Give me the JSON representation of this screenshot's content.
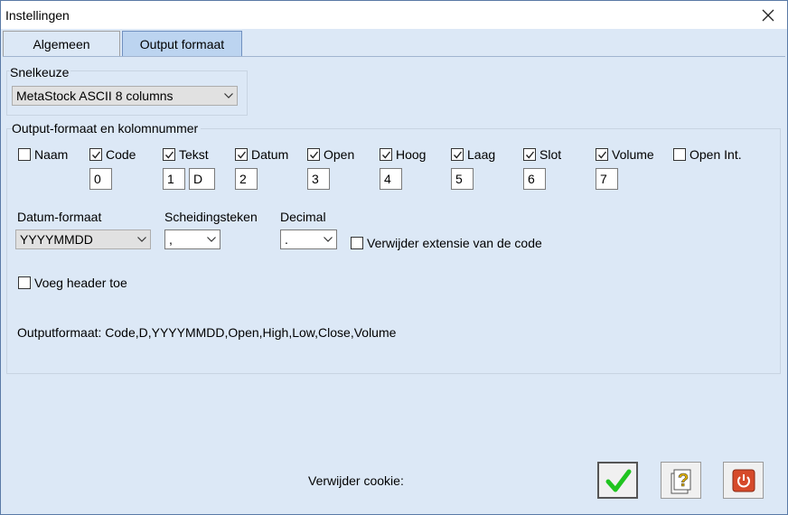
{
  "window": {
    "title": "Instellingen",
    "close_icon": "close-icon"
  },
  "tabs": [
    {
      "label": "Algemeen"
    },
    {
      "label": "Output formaat"
    }
  ],
  "snelkeuze": {
    "label": "Snelkeuze",
    "selected": "MetaStock ASCII 8 columns"
  },
  "output_group": {
    "label": "Output-formaat en kolomnummer",
    "fields": [
      {
        "label": "Naam",
        "checked": false
      },
      {
        "label": "Code",
        "checked": true,
        "col": "0"
      },
      {
        "label": "Tekst",
        "checked": true,
        "col": "1",
        "extra": "D"
      },
      {
        "label": "Datum",
        "checked": true,
        "col": "2"
      },
      {
        "label": "Open",
        "checked": true,
        "col": "3"
      },
      {
        "label": "Hoog",
        "checked": true,
        "col": "4"
      },
      {
        "label": "Laag",
        "checked": true,
        "col": "5"
      },
      {
        "label": "Slot",
        "checked": true,
        "col": "6"
      },
      {
        "label": "Volume",
        "checked": true,
        "col": "7"
      },
      {
        "label": "Open Int.",
        "checked": false
      }
    ]
  },
  "datum_formaat": {
    "label": "Datum-formaat",
    "selected": "YYYYMMDD"
  },
  "scheidingsteken": {
    "label": "Scheidingsteken",
    "selected": ","
  },
  "decimal": {
    "label": "Decimal",
    "selected": "."
  },
  "verwijder_extensie": {
    "label": "Verwijder extensie van de code",
    "checked": false
  },
  "voeg_header": {
    "label": "Voeg header toe",
    "checked": false
  },
  "outputformaat": "Outputformaat: Code,D,YYYYMMDD,Open,High,Low,Close,Volume",
  "verwijder_cookie": "Verwijder cookie:",
  "buttons": {
    "ok": "checkmark-icon",
    "help": "help-icon",
    "exit": "power-icon"
  }
}
